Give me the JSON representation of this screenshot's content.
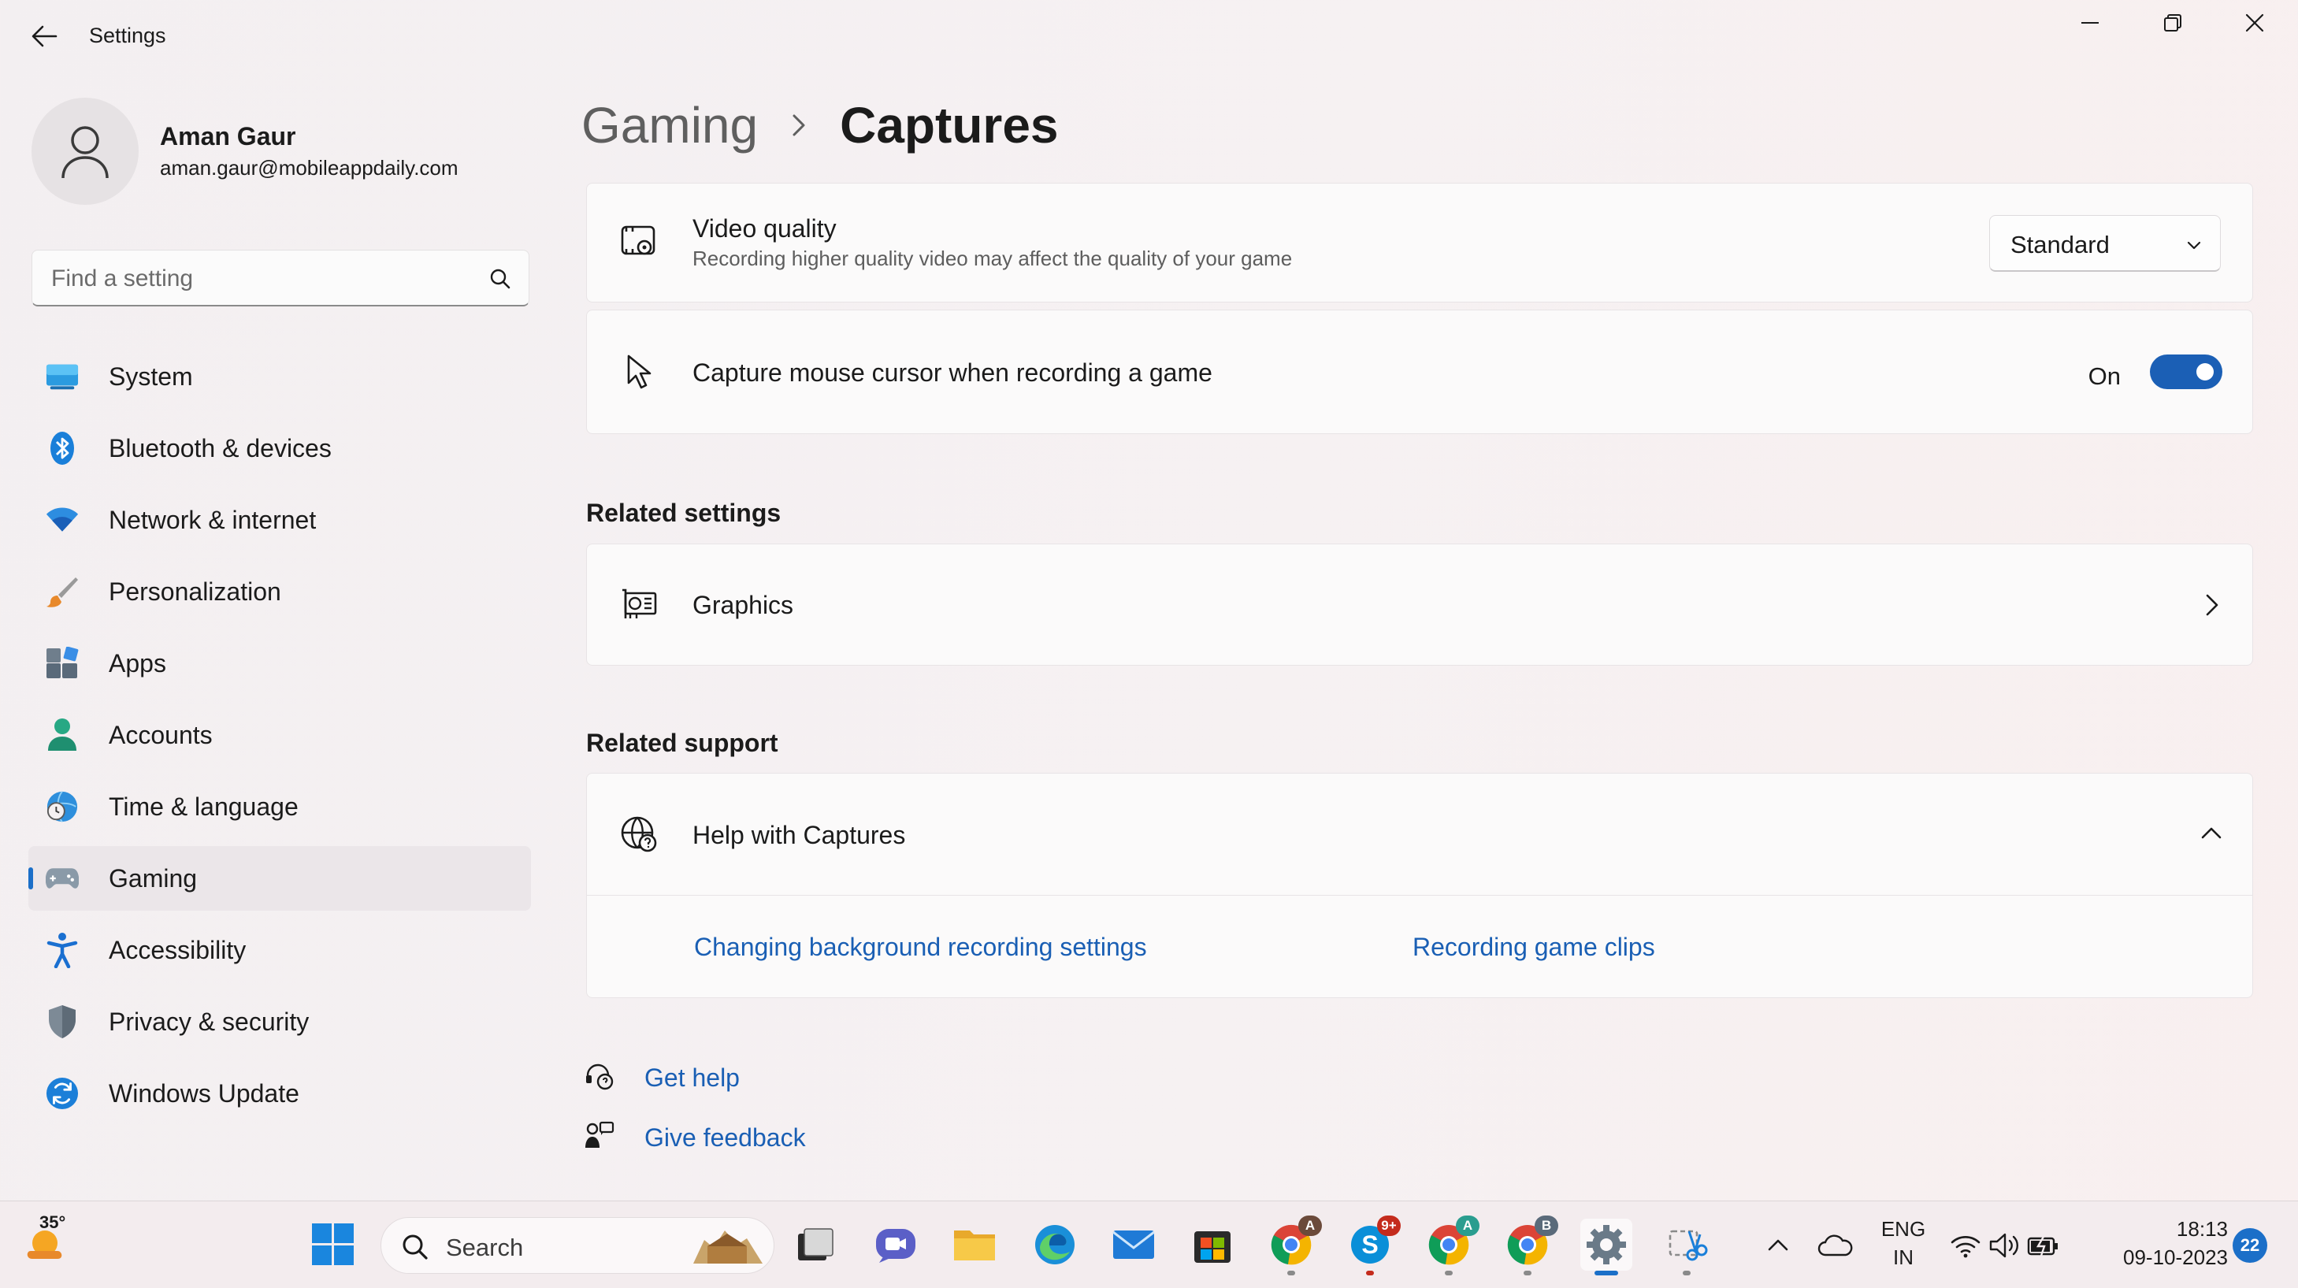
{
  "window": {
    "title": "Settings"
  },
  "profile": {
    "name": "Aman Gaur",
    "email": "aman.gaur@mobileappdaily.com"
  },
  "search": {
    "placeholder": "Find a setting"
  },
  "nav": {
    "items": [
      {
        "label": "System",
        "icon": "system-icon"
      },
      {
        "label": "Bluetooth & devices",
        "icon": "bluetooth-icon"
      },
      {
        "label": "Network & internet",
        "icon": "wifi-icon"
      },
      {
        "label": "Personalization",
        "icon": "brush-icon"
      },
      {
        "label": "Apps",
        "icon": "apps-icon"
      },
      {
        "label": "Accounts",
        "icon": "accounts-icon"
      },
      {
        "label": "Time & language",
        "icon": "globe-clock-icon"
      },
      {
        "label": "Gaming",
        "icon": "gamepad-icon",
        "active": true
      },
      {
        "label": "Accessibility",
        "icon": "accessibility-icon"
      },
      {
        "label": "Privacy & security",
        "icon": "shield-icon"
      },
      {
        "label": "Windows Update",
        "icon": "update-icon"
      }
    ]
  },
  "header": {
    "parent": "Gaming",
    "current": "Captures"
  },
  "video_quality": {
    "title": "Video quality",
    "description": "Recording higher quality video may affect the quality of your game",
    "value": "Standard"
  },
  "capture_cursor": {
    "title": "Capture mouse cursor when recording a game",
    "state_label": "On",
    "enabled": true
  },
  "related_settings": {
    "heading": "Related settings",
    "graphics_label": "Graphics"
  },
  "related_support": {
    "heading": "Related support",
    "help_title": "Help with Captures",
    "links": [
      "Changing background recording settings",
      "Recording game clips"
    ]
  },
  "footer_links": {
    "get_help": "Get help",
    "give_feedback": "Give feedback"
  },
  "taskbar": {
    "weather_temp": "35°",
    "search_label": "Search",
    "skype_badge": "9+",
    "chrome_profile_a1": "A",
    "chrome_profile_a2": "A",
    "chrome_profile_b": "B",
    "language_line1": "ENG",
    "language_line2": "IN",
    "time": "18:13",
    "date": "09-10-2023",
    "notification_count": "22"
  },
  "colors": {
    "accent": "#1b5fb5",
    "link": "#1a5fb4",
    "background": "#f4f0f1"
  }
}
